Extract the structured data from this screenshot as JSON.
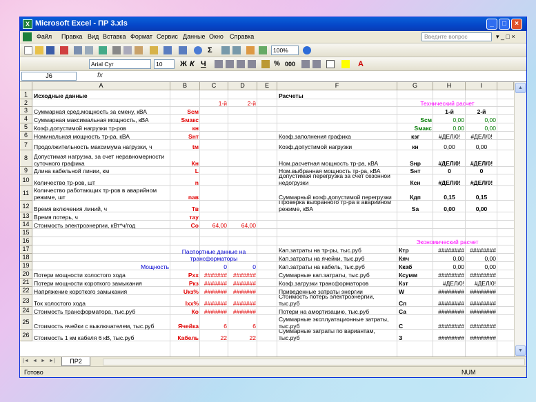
{
  "title": "Microsoft Excel - ПР 3.xls",
  "menu": [
    "Файл",
    "Правка",
    "Вид",
    "Вставка",
    "Формат",
    "Сервис",
    "Данные",
    "Окно",
    "Справка"
  ],
  "ask_placeholder": "Введите вопрос",
  "font_name": "Arial Cyr",
  "font_size": "10",
  "zoom": "100%",
  "cell_ref": "J6",
  "fx": "fx",
  "columns": [
    "A",
    "B",
    "C",
    "D",
    "E",
    "F",
    "G",
    "H",
    "I"
  ],
  "rows": [
    "1",
    "2",
    "3",
    "4",
    "5",
    "6",
    "7",
    "8",
    "9",
    "10",
    "11",
    "12",
    "13",
    "14",
    "15",
    "16",
    "17",
    "18",
    "19",
    "20",
    "21",
    "22",
    "23",
    "24",
    "25",
    "26"
  ],
  "sheet_tab": "ПР2",
  "status_left": "Готово",
  "status_right": "NUM",
  "left_section": {
    "header": "Исходные данные",
    "col_c_head": "1-й",
    "col_d_head": "2-й",
    "passport_header": "Паспортные данные на трансформаторы",
    "rows": [
      {
        "label": "Суммарная сред.мощность за смену, кВА",
        "sym": "Sсм"
      },
      {
        "label": "Суммарная максимальная мощность, кВА",
        "sym": "Sмакс"
      },
      {
        "label": "Коэф.допустимой нагрузки тр-ров",
        "sym": "кн"
      },
      {
        "label": "Номинальная мощность тр-ра, кВА",
        "sym": "Sнт"
      },
      {
        "label": "Продолжительность максимума нагрузки, ч",
        "sym": "tм"
      },
      {
        "label": "Допустимая нагрузка, за счет неравномерности суточного графика",
        "sym": "Кн"
      },
      {
        "label": "Длина кабельной линии, км",
        "sym": "L"
      },
      {
        "label": "Количество тр-ров, шт",
        "sym": "n"
      },
      {
        "label": "Количество работающих тр-ров в аварийном режиме, шт",
        "sym": "nав"
      },
      {
        "label": "Время включения линий, ч",
        "sym": "Тв"
      },
      {
        "label": "Время потерь, ч",
        "sym": "тау"
      },
      {
        "label": "Стоимость электроэнергии, кВт*ч/год",
        "sym": "Со",
        "c": "64,00",
        "d": "64,00"
      },
      {
        "label": "Мощность",
        "sym": "",
        "c": "0",
        "d": "0"
      },
      {
        "label": "Потери мощности холостого хода",
        "sym": "Pxx",
        "c": "#######",
        "d": "#######"
      },
      {
        "label": "Потери мощности короткого замыкания",
        "sym": "Pкз",
        "c": "#######",
        "d": "#######"
      },
      {
        "label": "Напряжение короткого замыкания",
        "sym": "Uкз%",
        "c": "#######",
        "d": "#######"
      },
      {
        "label": "Ток холостого хода",
        "sym": "Ixx%",
        "c": "#######",
        "d": "#######"
      },
      {
        "label": "Стоимость трансформатора, тыс.руб",
        "sym": "Ко",
        "c": "#######",
        "d": "#######"
      },
      {
        "label": "Стоимость ячейки с выключателем, тыс.руб",
        "sym": "Ячейка",
        "c": "6",
        "d": "6"
      },
      {
        "label": "Стоимость 1 км кабеля 6 кВ, тыс.руб",
        "sym": "Кабель",
        "c": "22",
        "d": "22"
      }
    ]
  },
  "right_section": {
    "header": "Расчеты",
    "tech_header": "Технический расчет",
    "econ_header": "Экономический расчет",
    "tech_col_h": "1-й",
    "tech_col_i": "2-й",
    "tech_rows": [
      {
        "label": "",
        "sym": "Sсм",
        "h": "0,00",
        "i": "0,00"
      },
      {
        "label": "",
        "sym": "Sмакс",
        "h": "0,00",
        "i": "0,00"
      },
      {
        "label": "Коэф.заполнения графика",
        "sym": "кзг",
        "h": "#ДЕЛ/0!",
        "i": "#ДЕЛ/0!"
      },
      {
        "label": "Коэф.допустимой нагрузки",
        "sym": "кн",
        "h": "0,00",
        "i": "0,00"
      },
      {
        "label": "Ном.расчетная мощность тр-ра, кВА",
        "sym": "Sнр",
        "h": "#ДЕЛ/0!",
        "i": "#ДЕЛ/0!"
      },
      {
        "label": "Ном.выбранная мощность тр-ра, кВА",
        "sym": "Sнт",
        "h": "0",
        "i": "0"
      },
      {
        "label": "Допустимая перегрузка за счет сезонной недогрузки",
        "sym": "Ксн",
        "h": "#ДЕЛ/0!",
        "i": "#ДЕЛ/0!"
      },
      {
        "label": "Суммарный коэф.допустимой перегрузки",
        "sym": "Кдп",
        "h": "0,15",
        "i": "0,15"
      },
      {
        "label": "Проверка выбранного тр-ра в аварийном режиме, кВА",
        "sym": "Sa",
        "h": "0,00",
        "i": "0,00"
      }
    ],
    "econ_rows": [
      {
        "label": "Кап.затраты на тр-ры, тыс.руб",
        "sym": "Ктр",
        "h": "########",
        "i": "########"
      },
      {
        "label": "Кап.затраты на ячейки, тыс.руб",
        "sym": "Кяч",
        "h": "0,00",
        "i": "0,00"
      },
      {
        "label": "Кап.затраты на кабель, тыс.руб",
        "sym": "Ккаб",
        "h": "0,00",
        "i": "0,00"
      },
      {
        "label": "Суммарные кап.затраты, тыс.руб",
        "sym": "Ксумм",
        "h": "########",
        "i": "########"
      },
      {
        "label": "Коэф.загрузки трансформаторов",
        "sym": "Кзт",
        "h": "#ДЕЛ/0!",
        "i": "#ДЕЛ/0!"
      },
      {
        "label": "Приведенные затраты энергии",
        "sym": "W",
        "h": "########",
        "i": "########"
      },
      {
        "label": "Стоимость потерь электроэнергии, тыс.руб",
        "sym": "Сп",
        "h": "########",
        "i": "########"
      },
      {
        "label": "Потери на амортизацию, тыс.руб",
        "sym": "Са",
        "h": "########",
        "i": "########"
      },
      {
        "label": "Суммарные эксплуатационные затраты, тыс.руб",
        "sym": "С",
        "h": "########",
        "i": "########"
      },
      {
        "label": "Суммарные затраты по вариантам, тыс.руб",
        "sym": "З",
        "h": "########",
        "i": "########"
      }
    ]
  }
}
